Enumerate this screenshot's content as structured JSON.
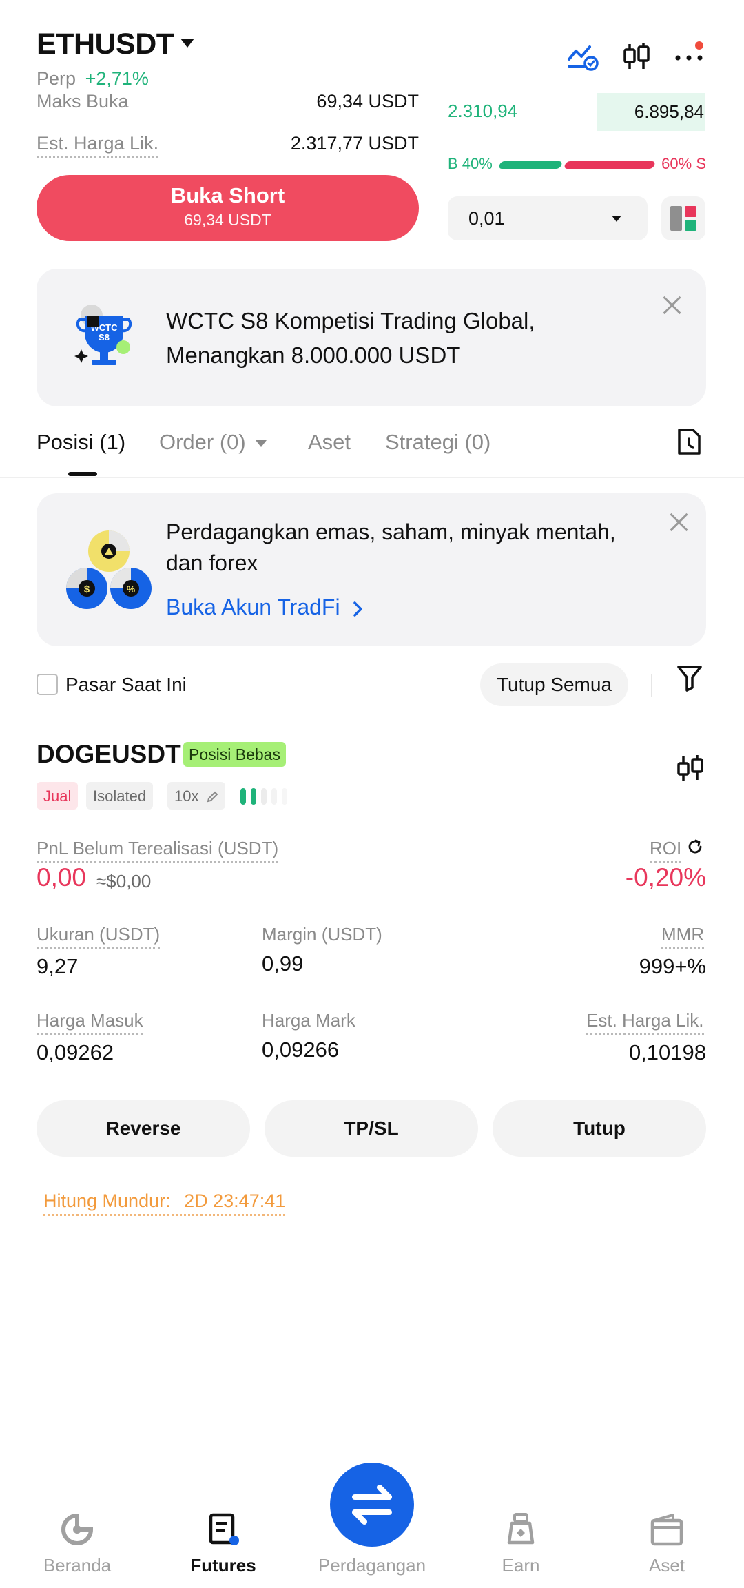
{
  "header": {
    "pair": "ETHUSDT",
    "type": "Perp",
    "change": "+2,71%"
  },
  "order_form": {
    "max_open_label": "Maks Buka",
    "max_open_value": "69,34 USDT",
    "liq_label": "Est. Harga Lik.",
    "liq_value": "2.317,77 USDT",
    "short_button_label": "Buka Short",
    "short_button_sub": "69,34 USDT"
  },
  "orderbook": {
    "price": "2.310,94",
    "amount": "6.895,84",
    "buy_ratio_label": "B 40%",
    "sell_ratio_label": "60% S",
    "buy_ratio": 0.4,
    "sell_ratio": 0.6,
    "precision": "0,01"
  },
  "banner_wctc": {
    "text": "WCTC S8 Kompetisi Trading Global, Menangkan 8.000.000 USDT",
    "logo_text_1": "WCTC",
    "logo_text_2": "S8"
  },
  "tabs": [
    {
      "label": "Posisi (1)",
      "active": true
    },
    {
      "label": "Order (0)",
      "active": false
    },
    {
      "label": "Aset",
      "active": false
    },
    {
      "label": "Strategi (0)",
      "active": false
    }
  ],
  "banner_tradfi": {
    "text": "Perdagangkan emas, saham, minyak mentah, dan forex",
    "link": "Buka Akun TradFi"
  },
  "filters": {
    "current_market_label": "Pasar Saat Ini",
    "close_all_label": "Tutup Semua"
  },
  "position": {
    "symbol": "DOGEUSDT",
    "badge": "Posisi Bebas",
    "side": "Jual",
    "margin_mode": "Isolated",
    "leverage": "10x",
    "pnl_label": "PnL Belum Terealisasi (USDT)",
    "pnl_value": "0,00",
    "pnl_usd": "≈$0,00",
    "roi_label": "ROI",
    "roi_value": "-0,20%",
    "size_label": "Ukuran (USDT)",
    "size_value": "9,27",
    "margin_label": "Margin (USDT)",
    "margin_value": "0,99",
    "mmr_label": "MMR",
    "mmr_value": "999+%",
    "entry_label": "Harga Masuk",
    "entry_value": "0,09262",
    "mark_label": "Harga Mark",
    "mark_value": "0,09266",
    "liq_label": "Est. Harga Lik.",
    "liq_value": "0,10198",
    "reverse_label": "Reverse",
    "tpsl_label": "TP/SL",
    "close_label": "Tutup",
    "countdown_label": "Hitung Mundur:",
    "countdown_value": "2D 23:47:41"
  },
  "bottom_nav": [
    {
      "label": "Beranda",
      "icon": "home-icon",
      "active": false
    },
    {
      "label": "Futures",
      "icon": "futures-icon",
      "active": true
    },
    {
      "label": "Perdagangan",
      "icon": "trade-icon",
      "active": false
    },
    {
      "label": "Earn",
      "icon": "earn-icon",
      "active": false
    },
    {
      "label": "Aset",
      "icon": "wallet-icon",
      "active": false
    }
  ],
  "colors": {
    "green": "#1fb37a",
    "red": "#e8365b",
    "short_button": "#f04b60",
    "accent_blue": "#1663e5",
    "orange": "#f29a3c"
  }
}
